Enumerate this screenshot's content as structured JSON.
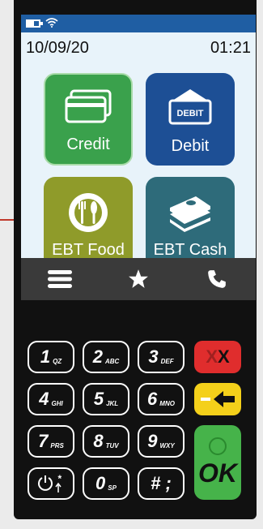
{
  "status": {
    "date": "10/09/20",
    "time": "01:21"
  },
  "tiles": [
    {
      "label": "Credit",
      "icon": "credit-card-icon"
    },
    {
      "label": "Debit",
      "icon": "debit-card-icon",
      "card_text": "DEBIT"
    },
    {
      "label": "EBT Food",
      "icon": "food-plate-icon"
    },
    {
      "label": "EBT Cash",
      "icon": "cash-stack-icon"
    }
  ],
  "nav": [
    "menu-icon",
    "star-icon",
    "phone-icon"
  ],
  "keypad": [
    {
      "num": "1",
      "sub": "QZ"
    },
    {
      "num": "2",
      "sub": "ABC"
    },
    {
      "num": "3",
      "sub": "DEF"
    },
    {
      "num": "4",
      "sub": "GHI"
    },
    {
      "num": "5",
      "sub": "JKL"
    },
    {
      "num": "6",
      "sub": "MNO"
    },
    {
      "num": "7",
      "sub": "PRS"
    },
    {
      "num": "8",
      "sub": "TUV"
    },
    {
      "num": "9",
      "sub": "WXY"
    },
    {
      "num": "",
      "sub": ""
    },
    {
      "num": "0",
      "sub": "SP"
    },
    {
      "num": "# ;",
      "sub": ""
    }
  ],
  "function_keys": {
    "cancel": "XX",
    "clear_symbol": "—",
    "ok": "OK"
  },
  "colors": {
    "status_bar": "#1f5ea3",
    "credit": "#3aa14c",
    "debit": "#1d4f95",
    "ebt_food": "#8f9b2a",
    "ebt_cash": "#2e6b7a",
    "callout": "#c0392b"
  }
}
